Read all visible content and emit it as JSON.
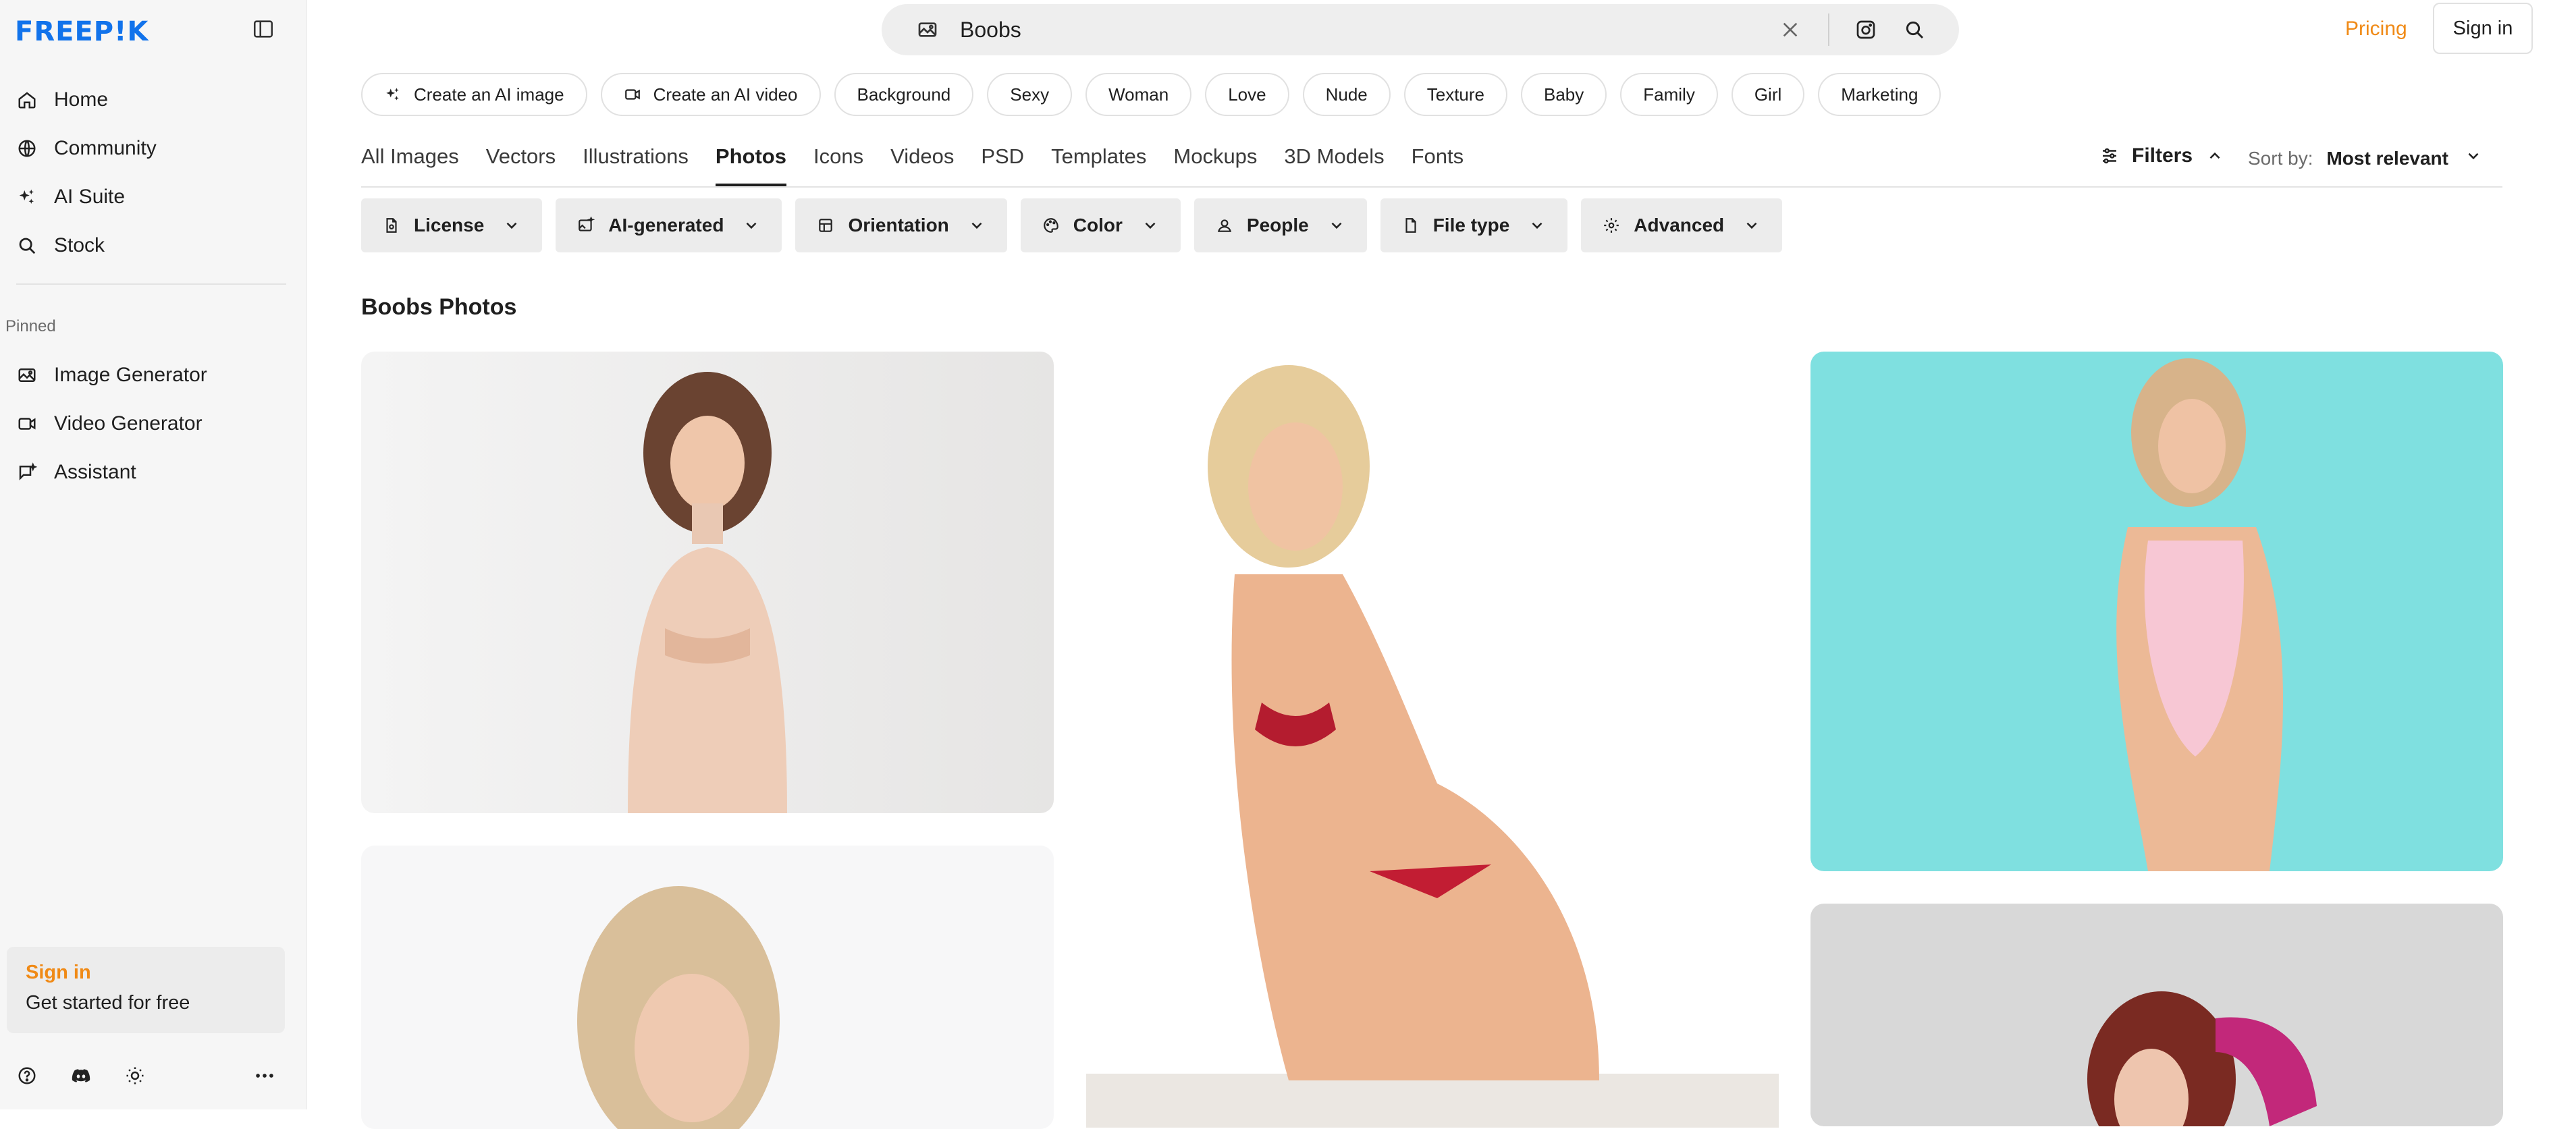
{
  "brand": {
    "logo_text": "FREEP!K",
    "accent": "#1273eb",
    "orange": "#f08a16"
  },
  "sidebar": {
    "nav": [
      {
        "label": "Home",
        "icon": "home-icon"
      },
      {
        "label": "Community",
        "icon": "globe-icon"
      },
      {
        "label": "AI Suite",
        "icon": "sparkle-icon"
      },
      {
        "label": "Stock",
        "icon": "search-icon"
      }
    ],
    "pinned_label": "Pinned",
    "pinned": [
      {
        "label": "Image Generator",
        "icon": "image-generator-icon"
      },
      {
        "label": "Video Generator",
        "icon": "video-icon"
      },
      {
        "label": "Assistant",
        "icon": "assistant-icon"
      }
    ],
    "signin_card": {
      "title": "Sign in",
      "subtitle": "Get started for free"
    }
  },
  "header": {
    "search_value": "Boobs",
    "pricing": "Pricing",
    "signin": "Sign in"
  },
  "chips": [
    {
      "label": "Create an AI image",
      "icon": "sparkle-icon"
    },
    {
      "label": "Create an AI video",
      "icon": "video-icon"
    },
    {
      "label": "Background"
    },
    {
      "label": "Sexy"
    },
    {
      "label": "Woman"
    },
    {
      "label": "Love"
    },
    {
      "label": "Nude"
    },
    {
      "label": "Texture"
    },
    {
      "label": "Baby"
    },
    {
      "label": "Family"
    },
    {
      "label": "Girl"
    },
    {
      "label": "Marketing"
    }
  ],
  "tabs": [
    {
      "label": "All Images"
    },
    {
      "label": "Vectors"
    },
    {
      "label": "Illustrations"
    },
    {
      "label": "Photos",
      "active": true
    },
    {
      "label": "Icons"
    },
    {
      "label": "Videos"
    },
    {
      "label": "PSD"
    },
    {
      "label": "Templates"
    },
    {
      "label": "Mockups"
    },
    {
      "label": "3D Models"
    },
    {
      "label": "Fonts"
    }
  ],
  "toolbar": {
    "filters_label": "Filters",
    "sort_label": "Sort by:",
    "sort_value": "Most relevant"
  },
  "filter_buttons": [
    {
      "label": "License",
      "icon": "license-icon"
    },
    {
      "label": "AI-generated",
      "icon": "ai-generated-icon"
    },
    {
      "label": "Orientation",
      "icon": "orientation-icon"
    },
    {
      "label": "Color",
      "icon": "palette-icon"
    },
    {
      "label": "People",
      "icon": "people-icon"
    },
    {
      "label": "File type",
      "icon": "file-icon"
    },
    {
      "label": "Advanced",
      "icon": "gear-icon"
    }
  ],
  "page_title": "Boobs Photos"
}
